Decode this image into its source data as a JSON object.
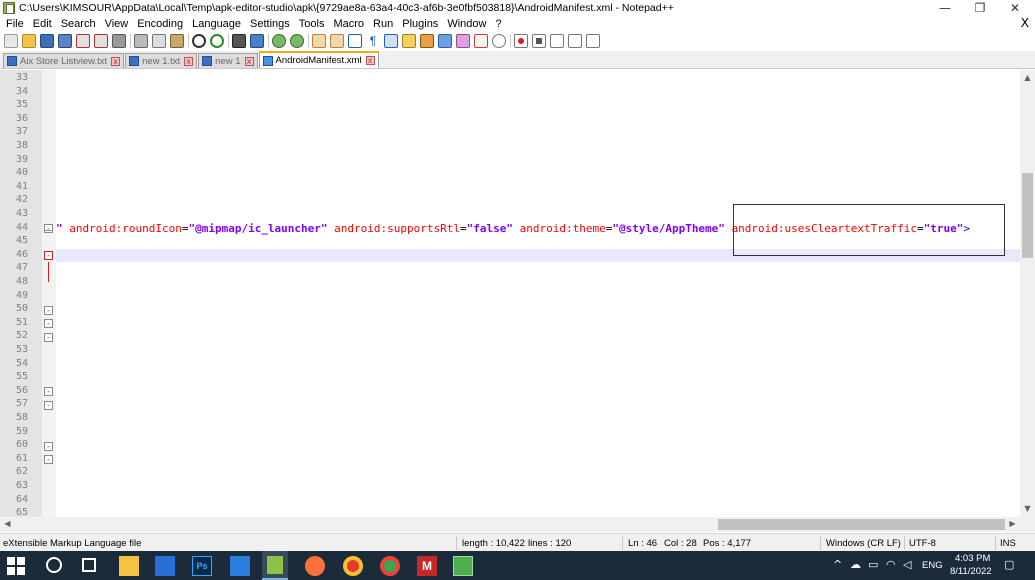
{
  "window": {
    "title": "C:\\Users\\KIMSOUR\\AppData\\Local\\Temp\\apk-editor-studio\\apk\\{9729ae8a-63a4-40c3-af6b-3e0fbf503818}\\AndroidManifest.xml - Notepad++",
    "minimize_glyph": "—",
    "maximize_glyph": "❐",
    "close_glyph": "✕"
  },
  "menu": [
    "File",
    "Edit",
    "Search",
    "View",
    "Encoding",
    "Language",
    "Settings",
    "Tools",
    "Macro",
    "Run",
    "Plugins",
    "Window",
    "?"
  ],
  "menu_close_glyph": "X",
  "tabs": [
    {
      "label": "Aix Store Listview.txt",
      "active": false
    },
    {
      "label": "new 1.txt",
      "active": false
    },
    {
      "label": "new 1",
      "active": false
    },
    {
      "label": "AndroidManifest.xml",
      "active": true
    }
  ],
  "tab_close_glyph": "x",
  "editor": {
    "line_numbers": [
      "33",
      "34",
      "35",
      "36",
      "37",
      "38",
      "39",
      "40",
      "41",
      "42",
      "43",
      "44",
      "45",
      "46",
      "47",
      "48",
      "49",
      "50",
      "51",
      "52",
      "53",
      "54",
      "55",
      "56",
      "57",
      "58",
      "59",
      "60",
      "61",
      "62",
      "63",
      "64",
      "65"
    ],
    "code_line_44": {
      "lead": "\"",
      "a1": "android:roundIcon",
      "v1": "\"@mipmap/ic_launcher\"",
      "a2": "android:supportsRtl",
      "v2": "\"false\"",
      "a3": "android:theme",
      "v3": "\"@style/AppTheme\"",
      "a4": "android:usesCleartextTraffic",
      "v4": "\"true\"",
      "end": ">"
    }
  },
  "status": {
    "file_type": "eXtensible Markup Language file",
    "length": "length : 10,422",
    "lines": "lines : 120",
    "ln": "Ln : 46",
    "col": "Col : 28",
    "pos": "Pos : 4,177",
    "eol": "Windows (CR LF)",
    "encoding": "UTF-8",
    "mode": "INS"
  },
  "taskbar": {
    "lang": "ENG",
    "time": "4:03 PM",
    "date": "8/11/2022"
  }
}
